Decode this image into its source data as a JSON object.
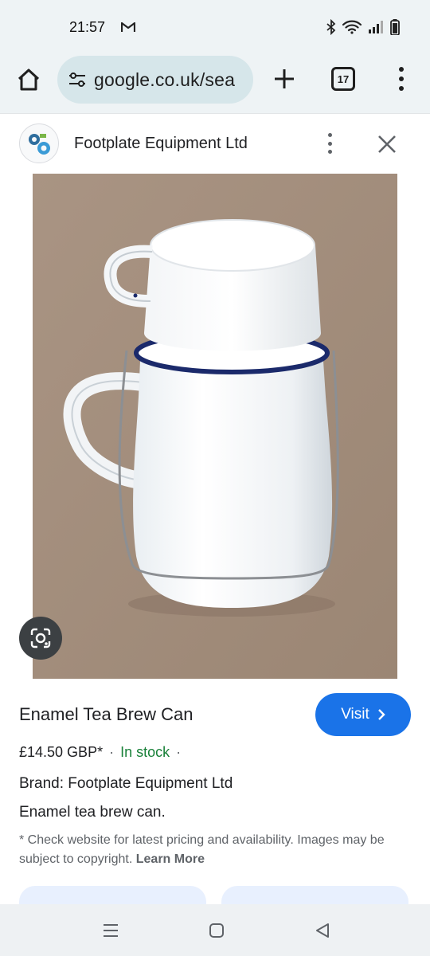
{
  "status_bar": {
    "time": "21:57",
    "icons": [
      "gmail-icon",
      "bluetooth-icon",
      "wifi-icon",
      "signal-icon",
      "battery-icon"
    ]
  },
  "browser": {
    "url": "google.co.uk/sea",
    "tab_count": "17",
    "icons": [
      "home-icon",
      "tune-icon",
      "plus-icon",
      "tabs-icon",
      "more-vert-icon"
    ]
  },
  "sheet": {
    "site_name": "Footplate Equipment Ltd",
    "icons": [
      "site-logo-icon",
      "more-vert-icon",
      "close-icon"
    ]
  },
  "product": {
    "title": "Enamel Tea Brew Can",
    "visit_label": "Visit",
    "price": "£14.50 GBP*",
    "separator": "·",
    "stock": "In stock",
    "brand": "Brand: Footplate Equipment Ltd",
    "description": "Enamel tea brew can.",
    "disclaimer": "* Check website for latest pricing and availability. Images may be subject to copyright.",
    "learn_more": "Learn More"
  },
  "colors": {
    "accent": "#1a73e8",
    "in_stock": "#188038",
    "url_pill": "#d6e6ea",
    "chrome_bg": "#eef3f5"
  },
  "nav": {
    "icons": [
      "recents-icon",
      "home-icon",
      "back-icon"
    ]
  }
}
